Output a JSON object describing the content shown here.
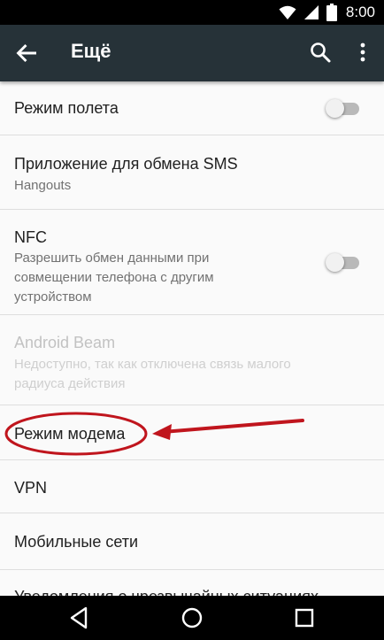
{
  "status_bar": {
    "time": "8:00",
    "icons": [
      "wifi-icon",
      "cell-signal-icon",
      "battery-icon"
    ]
  },
  "toolbar": {
    "title": "Ещё",
    "back_icon": "arrow-back-icon",
    "search_icon": "search-icon",
    "more_icon": "more-vert-icon",
    "color": "#263238"
  },
  "settings": {
    "airplane_mode": {
      "title": "Режим полета",
      "switch_on": false
    },
    "sms_app": {
      "title": "Приложение для обмена SMS",
      "summary": "Hangouts"
    },
    "nfc": {
      "title": "NFC",
      "summary_lines": [
        "Разрешить обмен данными при",
        "совмещении телефона с другим",
        "устройством"
      ],
      "switch_on": false
    },
    "android_beam": {
      "title": "Android Beam",
      "summary_lines": [
        "Недоступно, так как отключена связь малого",
        "радиуса действия"
      ],
      "enabled": false
    },
    "tethering": {
      "title": "Режим модема"
    },
    "vpn": {
      "title": "VPN"
    },
    "mobile_networks": {
      "title": "Мобильные сети"
    },
    "emergency_alerts": {
      "title": "Уведомления о чрезвычайных ситуациях"
    }
  },
  "annotation": {
    "highlight_color": "#c0151d",
    "target": "tethering"
  },
  "nav_bar": {
    "back_icon": "nav-back-icon",
    "home_icon": "nav-home-icon",
    "recents_icon": "nav-recents-icon"
  }
}
